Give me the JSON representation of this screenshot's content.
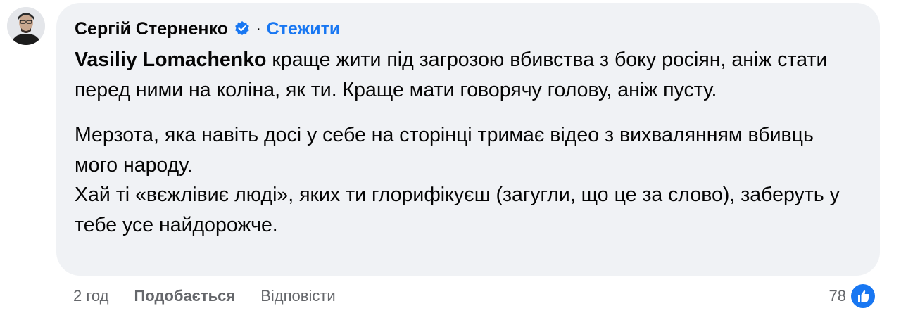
{
  "comment": {
    "author": "Сергій Стерненко",
    "follow": "Стежити",
    "separator": "·",
    "mention": "Vasiliy Lomachenko",
    "paragraph1_rest": " краще жити під загрозою вбивства з боку росіян, аніж стати перед ними на коліна, як ти. Краще мати говорячу голову, аніж пусту.",
    "paragraph2": "Мерзота, яка навіть досі у себе на сторінці тримає відео з вихвалянням вбивць мого народу.",
    "paragraph3": "Хай ті «вєжлівиє люді», яких ти глорифікуєш (загугли, що це за слово), заберуть у тебе усе найдорожче."
  },
  "actions": {
    "time": "2 год",
    "like": "Подобається",
    "reply": "Відповісти"
  },
  "reactions": {
    "count": "78",
    "icon": "like-icon"
  },
  "colors": {
    "accent": "#1877f2",
    "bubble": "#f0f2f5",
    "muted": "#65676b"
  }
}
